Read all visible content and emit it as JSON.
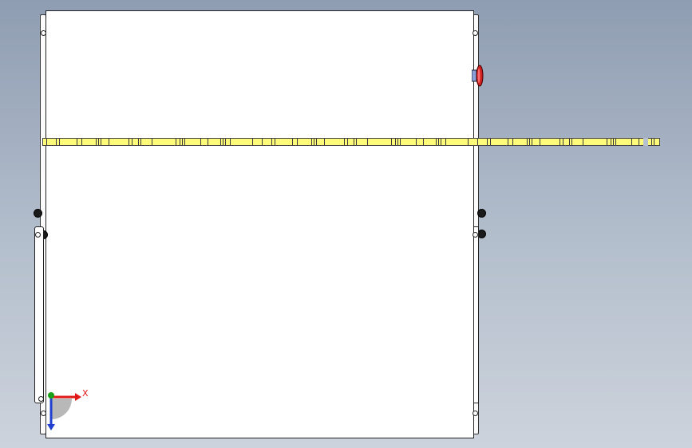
{
  "viewport": {
    "background": "gradient-gray-blue",
    "accent_colors": {
      "strip": "#fffb7a",
      "x_axis": "#e01818",
      "y_axis": "#18a018",
      "z_axis": "#2040d0",
      "estop": "#c02020"
    }
  },
  "triad": {
    "x_label": "X"
  },
  "icons": [
    "emergency-stop-icon",
    "screw-icon",
    "knob-icon",
    "axis-triad-icon"
  ]
}
